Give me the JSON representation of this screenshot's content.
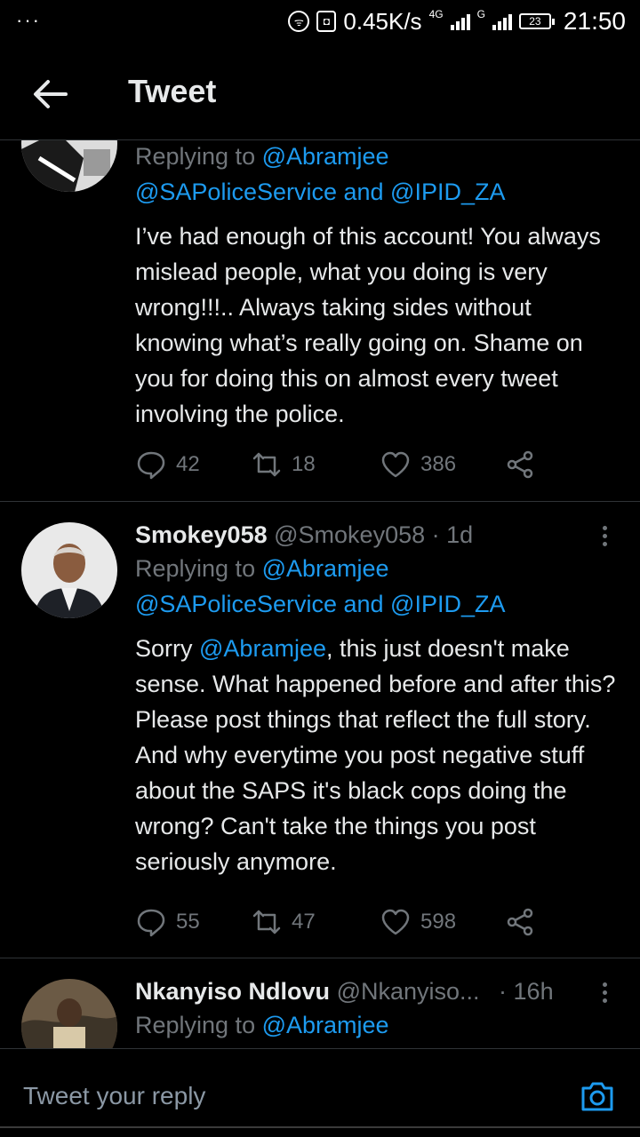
{
  "status_bar": {
    "dots": "···",
    "speed": "0.45K/s",
    "net1": "4G",
    "net2": "G",
    "battery": "23",
    "time": "21:50"
  },
  "header": {
    "title": "Tweet"
  },
  "tweets": [
    {
      "replying_prefix": "Replying to ",
      "replying_mentions": "@Abramjee",
      "replying_line2": "@SAPoliceService and @IPID_ZA",
      "text": "I’ve had enough of this account! You always mislead people, what you doing is very wrong!!!.. Always taking sides without knowing what’s really going on. Shame on you for doing this on almost every tweet involving the police.",
      "replies": "42",
      "retweets": "18",
      "likes": "386"
    },
    {
      "name": "Smokey058",
      "handle": "@Smokey058",
      "time": "· 1d",
      "replying_prefix": "Replying to ",
      "replying_mentions": "@Abramjee",
      "replying_line2": "@SAPoliceService and @IPID_ZA",
      "text_prefix": "Sorry ",
      "text_mention": "@Abramjee",
      "text_rest": ", this just doesn't make sense. What happened before and after this? Please post things that reflect the full story. And why everytime you post negative stuff about the SAPS it's black cops doing the wrong? Can't take the things you post seriously anymore.",
      "replies": "55",
      "retweets": "47",
      "likes": "598"
    },
    {
      "name": "Nkanyiso Ndlovu",
      "handle": "@Nkanyiso...",
      "time": "· 16h",
      "replying_prefix": "Replying to ",
      "replying_mentions": "@Abramjee"
    }
  ],
  "compose": {
    "placeholder": "Tweet your reply"
  },
  "colors": {
    "accent": "#1d9bf0",
    "muted": "#71767b",
    "background": "#000000"
  }
}
